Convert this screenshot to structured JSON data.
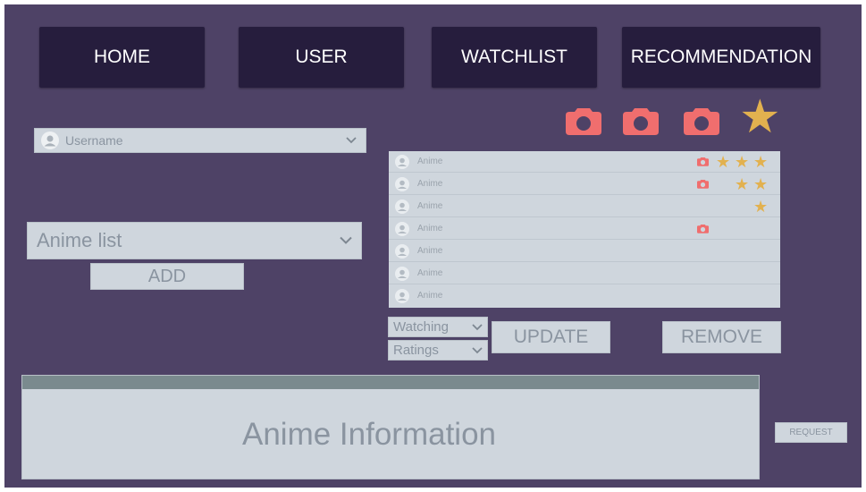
{
  "nav": {
    "home": "HOME",
    "user": "USER",
    "watchlist": "WATCHLIST",
    "recommendation": "RECOMMENDATION"
  },
  "user_select": {
    "placeholder": "Username"
  },
  "anime_select": {
    "placeholder": "Anime list"
  },
  "add_label": "ADD",
  "watchlist": {
    "rows": [
      {
        "label": "Anime",
        "photo": true,
        "stars": 3
      },
      {
        "label": "Anime",
        "photo": true,
        "stars": 2
      },
      {
        "label": "Anime",
        "photo": false,
        "stars": 1
      },
      {
        "label": "Anime",
        "photo": true,
        "stars": 0
      },
      {
        "label": "Anime",
        "photo": false,
        "stars": 0
      },
      {
        "label": "Anime",
        "photo": false,
        "stars": 0
      },
      {
        "label": "Anime",
        "photo": false,
        "stars": 0
      }
    ]
  },
  "status_select": {
    "value": "Watching"
  },
  "ratings_select": {
    "value": "Ratings"
  },
  "update_label": "UPDATE",
  "remove_label": "REMOVE",
  "info_panel": {
    "title": "Anime Information"
  },
  "request_label": "REQUEST",
  "header_icons": [
    "camera-icon",
    "camera-icon",
    "camera-icon",
    "star-icon"
  ],
  "colors": {
    "background": "#4e4266",
    "nav": "#261d3d",
    "camera": "#f06e6e",
    "star": "#e2b14f",
    "panel": "#cfd6dd",
    "panel_header": "#7a8a8e"
  }
}
